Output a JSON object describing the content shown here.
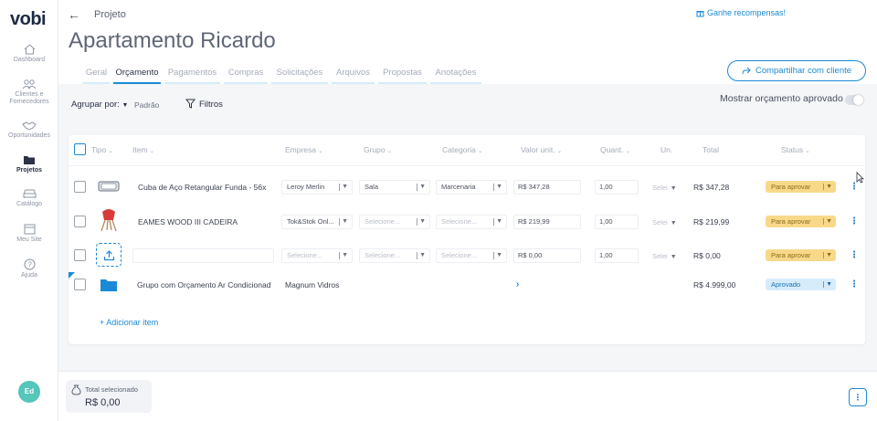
{
  "app": {
    "logo": "vobi"
  },
  "sidebar": {
    "items": [
      {
        "label": "Dashboard"
      },
      {
        "label": "Clientes e Fornecedores"
      },
      {
        "label": "Oportunidades"
      },
      {
        "label": "Projetos"
      },
      {
        "label": "Catálogo"
      },
      {
        "label": "Meu Site"
      },
      {
        "label": "Ajuda"
      }
    ],
    "avatar": "Ed"
  },
  "header": {
    "breadcrumb": "Projeto",
    "rewards": "Ganhe recompensas!",
    "title": "Apartamento Ricardo",
    "share_label": "Compartilhar com cliente",
    "tabs": [
      {
        "label": "Geral"
      },
      {
        "label": "Orçamento"
      },
      {
        "label": "Pagamentos"
      },
      {
        "label": "Compras"
      },
      {
        "label": "Solicitações"
      },
      {
        "label": "Arquivos"
      },
      {
        "label": "Propostas"
      },
      {
        "label": "Anotações"
      }
    ]
  },
  "toolbar": {
    "group_by_label": "Agrupar por:",
    "group_by_value": "Padrão",
    "filters_label": "Filtros",
    "show_approved_label": "Mostrar orçamento aprovado"
  },
  "table": {
    "columns": {
      "type": "Tipo",
      "item": "Item",
      "company": "Empresa",
      "group": "Grupo",
      "category": "Categoria",
      "unit_value": "Valor unit.",
      "quantity": "Quant.",
      "unit": "Un.",
      "total": "Total",
      "status": "Status"
    },
    "rows": [
      {
        "item": "Cuba de Aço Retangular Funda - 56x",
        "company": "Leroy Merlin",
        "group": "Sala",
        "category": "Marcenaria",
        "unit_value": "R$ 347,28",
        "quantity": "1,00",
        "unit": "Selei",
        "total": "R$ 347,28",
        "status": "Para aprovar"
      },
      {
        "item": "EAMES WOOD III CADEIRA",
        "company": "Tok&Stok Onl...",
        "group": "Selecione...",
        "category": "Selecione...",
        "unit_value": "R$ 219,99",
        "quantity": "1,00",
        "unit": "Selei",
        "total": "R$ 219,99",
        "status": "Para aprovar"
      },
      {
        "item": "",
        "company": "Selecione...",
        "group": "Selecione...",
        "category": "Selecione...",
        "unit_value": "R$ 0,00",
        "quantity": "1,00",
        "unit": "Selei",
        "total": "R$ 0,00",
        "status": "Para aprovar"
      },
      {
        "item": "Grupo com Orçamento Ar Condicionad",
        "company": "Magnum Vidros",
        "total": "R$ 4.999,00",
        "status": "Aprovado"
      }
    ],
    "add_item_label": "+ Adicionar item"
  },
  "footer": {
    "total_label": "Total selecionado",
    "total_value": "R$ 0,00"
  },
  "colors": {
    "accent": "#1a8ad6",
    "pending": "#f8d98a",
    "approved": "#d7ecfb"
  }
}
